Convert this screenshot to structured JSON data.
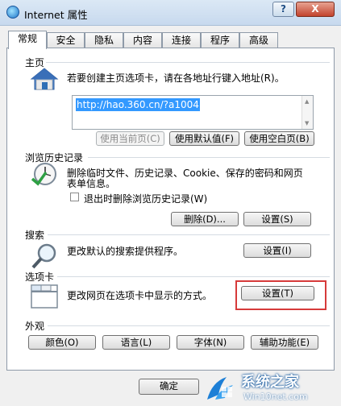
{
  "window": {
    "title": "Internet 属性",
    "help_label": "?",
    "close_label": "X"
  },
  "tabs": [
    {
      "label": "常规",
      "active": true
    },
    {
      "label": "安全"
    },
    {
      "label": "隐私"
    },
    {
      "label": "内容"
    },
    {
      "label": "连接"
    },
    {
      "label": "程序"
    },
    {
      "label": "高级"
    }
  ],
  "homepage": {
    "heading": "主页",
    "description": "若要创建主页选项卡，请在各地址行键入地址(R)。",
    "url": "http://hao.360.cn/?a1004",
    "use_current_label": "使用当前页(C)",
    "use_default_label": "使用默认值(F)",
    "use_blank_label": "使用空白页(B)"
  },
  "history": {
    "heading": "浏览历史记录",
    "description_line1": "删除临时文件、历史记录、Cookie、保存的密码和网页",
    "description_line2": "表单信息。",
    "delete_on_exit_label": "退出时删除浏览历史记录(W)",
    "delete_label": "删除(D)...",
    "settings_label": "设置(S)"
  },
  "search": {
    "heading": "搜索",
    "description": "更改默认的搜索提供程序。",
    "settings_label": "设置(I)"
  },
  "tabs_section": {
    "heading": "选项卡",
    "description": "更改网页在选项卡中显示的方式。",
    "settings_label": "设置(T)"
  },
  "appearance": {
    "heading": "外观",
    "colors_label": "颜色(O)",
    "languages_label": "语言(L)",
    "fonts_label": "字体(N)",
    "accessibility_label": "辅助功能(E)"
  },
  "footer": {
    "ok_label": "确定"
  },
  "watermark": {
    "name": "系统之家",
    "url": "Win10net.com"
  },
  "colors": {
    "highlight": "#d63a3a",
    "selection": "#3399ff"
  }
}
